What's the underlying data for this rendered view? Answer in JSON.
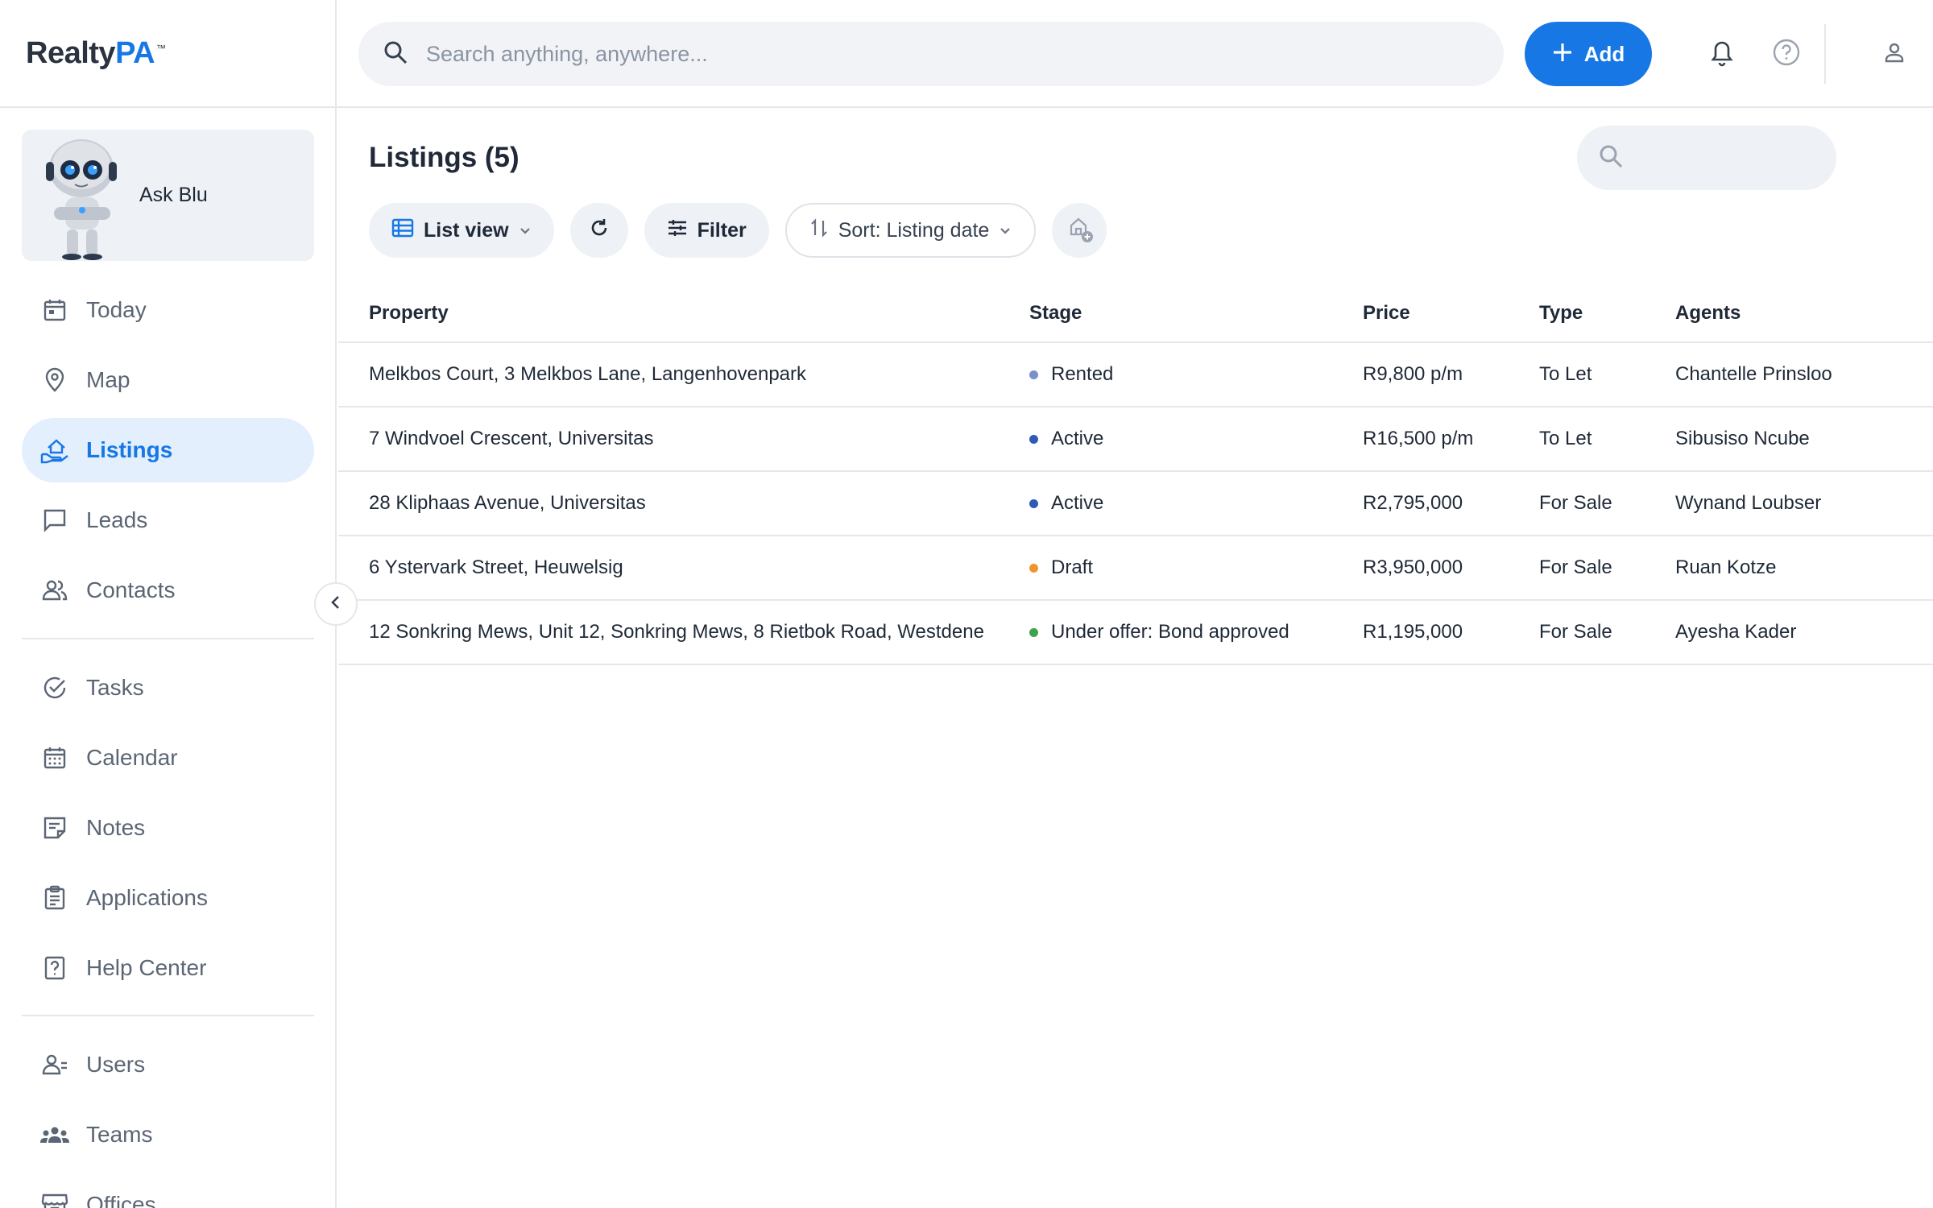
{
  "brand": {
    "name_part1": "Realty",
    "name_part2": "PA",
    "trademark": "™"
  },
  "header": {
    "search_placeholder": "Search anything, anywhere...",
    "add_label": "Add"
  },
  "sidebar": {
    "ask_blu_label": "Ask Blu",
    "group1": [
      {
        "label": "Today",
        "icon": "calendar-today-icon"
      },
      {
        "label": "Map",
        "icon": "map-pin-icon"
      },
      {
        "label": "Listings",
        "icon": "listings-hand-house-icon",
        "active": true
      },
      {
        "label": "Leads",
        "icon": "chat-bubble-icon"
      },
      {
        "label": "Contacts",
        "icon": "contacts-people-icon"
      }
    ],
    "group2": [
      {
        "label": "Tasks",
        "icon": "check-circle-icon"
      },
      {
        "label": "Calendar",
        "icon": "calendar-grid-icon"
      },
      {
        "label": "Notes",
        "icon": "note-icon"
      },
      {
        "label": "Applications",
        "icon": "clipboard-icon"
      },
      {
        "label": "Help Center",
        "icon": "help-square-icon"
      }
    ],
    "group3": [
      {
        "label": "Users",
        "icon": "users-icon"
      },
      {
        "label": "Teams",
        "icon": "teams-icon"
      },
      {
        "label": "Offices",
        "icon": "offices-storefront-icon"
      }
    ]
  },
  "main": {
    "title": "Listings (5)",
    "toolbar": {
      "view_label": "List view",
      "filter_label": "Filter",
      "sort_label": "Sort: Listing date"
    },
    "table": {
      "headers": {
        "property": "Property",
        "stage": "Stage",
        "price": "Price",
        "type": "Type",
        "agents": "Agents"
      },
      "rows": [
        {
          "property": "Melkbos Court, 3 Melkbos Lane, Langenhovenpark",
          "stage": "Rented",
          "stage_color": "#7b8fc9",
          "price": "R9,800 p/m",
          "type": "To Let",
          "agent": "Chantelle Prinsloo"
        },
        {
          "property": "7 Windvoel Crescent, Universitas",
          "stage": "Active",
          "stage_color": "#2f5bb7",
          "price": "R16,500 p/m",
          "type": "To Let",
          "agent": "Sibusiso Ncube"
        },
        {
          "property": "28 Kliphaas Avenue, Universitas",
          "stage": "Active",
          "stage_color": "#2f5bb7",
          "price": "R2,795,000",
          "type": "For Sale",
          "agent": "Wynand Loubser"
        },
        {
          "property": "6 Ystervark Street, Heuwelsig",
          "stage": "Draft",
          "stage_color": "#f0952e",
          "price": "R3,950,000",
          "type": "For Sale",
          "agent": "Ruan Kotze"
        },
        {
          "property": "12 Sonkring Mews, Unit 12, Sonkring Mews, 8 Rietbok Road, Westdene",
          "stage": "Under offer: Bond approved",
          "stage_color": "#3fa34d",
          "price": "R1,195,000",
          "type": "For Sale",
          "agent": "Ayesha Kader"
        }
      ]
    }
  },
  "colors": {
    "accent": "#1677e5",
    "active_bg": "#e3effd",
    "muted_text": "#5b6674"
  }
}
